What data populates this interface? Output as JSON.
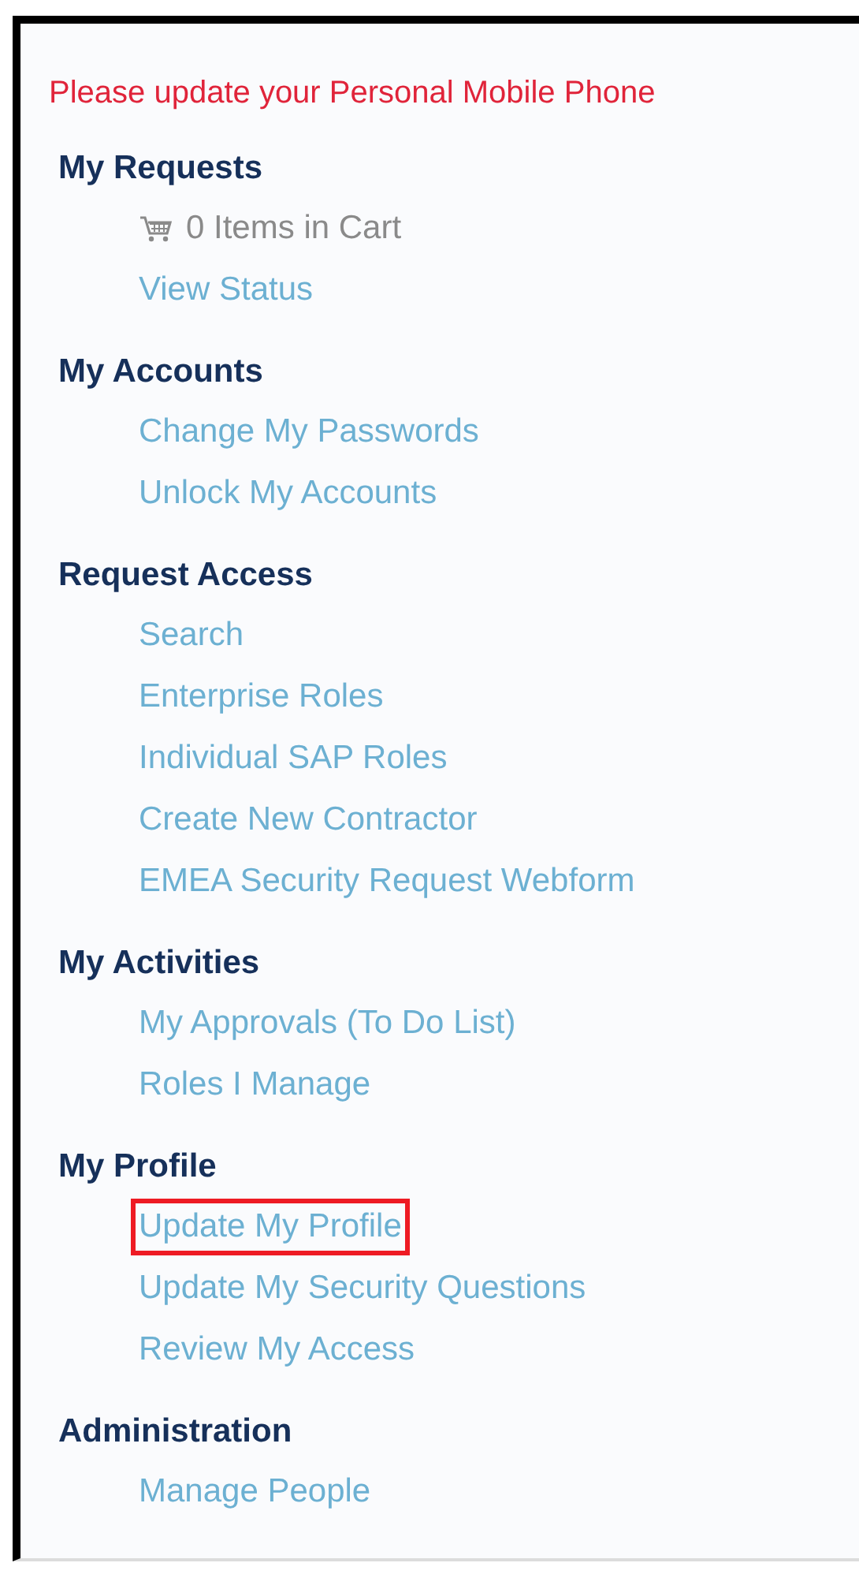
{
  "alert": "Please update your Personal Mobile Phone",
  "sections": [
    {
      "title": "My Requests",
      "items": [
        {
          "kind": "cart",
          "label": "0 Items in Cart"
        },
        {
          "kind": "link",
          "label": "View Status"
        }
      ]
    },
    {
      "title": "My Accounts",
      "items": [
        {
          "kind": "link",
          "label": "Change My Passwords"
        },
        {
          "kind": "link",
          "label": "Unlock My Accounts"
        }
      ]
    },
    {
      "title": "Request Access",
      "items": [
        {
          "kind": "link",
          "label": "Search"
        },
        {
          "kind": "link",
          "label": "Enterprise Roles"
        },
        {
          "kind": "link",
          "label": "Individual SAP Roles"
        },
        {
          "kind": "link",
          "label": "Create New Contractor"
        },
        {
          "kind": "link",
          "label": "EMEA Security Request Webform"
        }
      ]
    },
    {
      "title": "My Activities",
      "items": [
        {
          "kind": "link",
          "label": "My Approvals (To Do List)"
        },
        {
          "kind": "link",
          "label": "Roles I Manage"
        }
      ]
    },
    {
      "title": "My Profile",
      "items": [
        {
          "kind": "link",
          "label": "Update My Profile",
          "highlighted": true
        },
        {
          "kind": "link",
          "label": "Update My Security Questions"
        },
        {
          "kind": "link",
          "label": "Review My Access"
        }
      ]
    },
    {
      "title": "Administration",
      "items": [
        {
          "kind": "link",
          "label": "Manage People"
        }
      ]
    }
  ]
}
